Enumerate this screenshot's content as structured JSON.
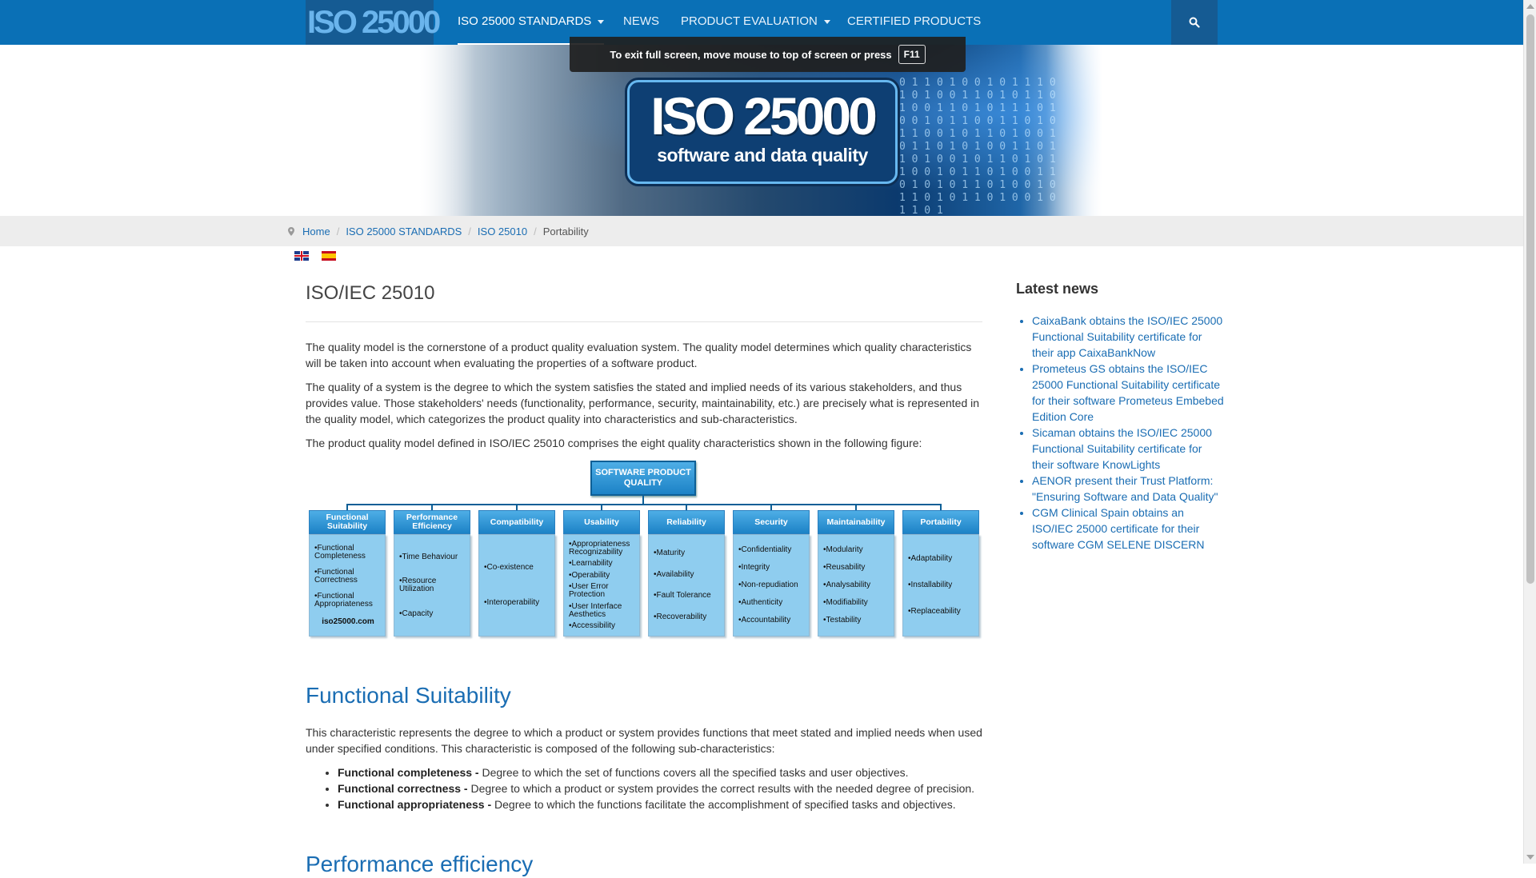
{
  "header": {
    "logo_text": "ISO 25000",
    "nav": [
      {
        "label": "ISO 25000 STANDARDS"
      },
      {
        "label": "NEWS"
      },
      {
        "label": "PRODUCT EVALUATION"
      },
      {
        "label": "CERTIFIED PRODUCTS"
      }
    ],
    "search_icon": "search-icon"
  },
  "fullscreen_notice": {
    "text": "To exit full screen, move mouse to top of screen or press",
    "key": "F11"
  },
  "banner": {
    "title": "ISO 25000",
    "subtitle": "software and data quality"
  },
  "breadcrumb": {
    "items": [
      "Home",
      "ISO 25000 STANDARDS",
      "ISO 25010"
    ],
    "current": "Portability"
  },
  "languages": [
    "en-flag-icon",
    "es-flag-icon"
  ],
  "main": {
    "title": "ISO/IEC 25010",
    "paragraphs": [
      "The quality model is the cornerstone of a product quality evaluation system. The quality model determines which quality characteristics will be taken into account when evaluating the properties of a software product.",
      "The quality of a system is the degree to which the system satisfies the stated and implied needs of its various stakeholders, and thus provides value. Those stakeholders' needs (functionality, performance, security, maintainability, etc.) are precisely what is represented in the quality model, which categorizes the product quality into characteristics and sub-characteristics.",
      "The product quality model defined in ISO/IEC 25010 comprises the eight quality characteristics shown in the following figure:"
    ],
    "figure": {
      "root": "SOFTWARE PRODUCT QUALITY",
      "watermark": "iso25000.com",
      "columns": [
        {
          "title": "Functional Suitability",
          "items": [
            "Functional Completeness",
            "Functional Correctness",
            "Functional Appropriateness"
          ]
        },
        {
          "title": "Performance Efficiency",
          "items": [
            "Time Behaviour",
            "Resource Utilization",
            "Capacity"
          ]
        },
        {
          "title": "Compatibility",
          "items": [
            "Co-existence",
            "Interoperability"
          ]
        },
        {
          "title": "Usability",
          "items": [
            "Appropriateness Recognizability",
            "Learnability",
            "Operability",
            "User Error Protection",
            "User Interface Aesthetics",
            "Accessibility"
          ]
        },
        {
          "title": "Reliability",
          "items": [
            "Maturity",
            "Availability",
            "Fault Tolerance",
            "Recoverability"
          ]
        },
        {
          "title": "Security",
          "items": [
            "Confidentiality",
            "Integrity",
            "Non-repudiation",
            "Authenticity",
            "Accountability"
          ]
        },
        {
          "title": "Maintainability",
          "items": [
            "Modularity",
            "Reusability",
            "Analysability",
            "Modifiability",
            "Testability"
          ]
        },
        {
          "title": "Portability",
          "items": [
            "Adaptability",
            "Installability",
            "Replaceability"
          ]
        }
      ]
    },
    "section1": {
      "title": "Functional Suitability",
      "intro": "This characteristic represents the degree to which a product or system provides functions that meet stated and implied needs when used under specified conditions. This characteristic is composed of the following sub-characteristics:",
      "bullets": [
        {
          "term": "Functional completeness -",
          "text": " Degree to which the set of functions covers all the specified tasks and user objectives."
        },
        {
          "term": "Functional correctness -",
          "text": " Degree to which a product or system provides the correct results with the needed degree of precision."
        },
        {
          "term": "Functional appropriateness -",
          "text": " Degree to which the functions facilitate the accomplishment of specified tasks and objectives."
        }
      ]
    },
    "section2": {
      "title": "Performance efficiency"
    }
  },
  "sidebar": {
    "title": "Latest news",
    "news": [
      "CaixaBank obtains the ISO/IEC 25000 Functional Suitability certificate for their app CaixaBankNow",
      "Prometeus GS obtains the ISO/IEC 25000 Functional Suitability certificate for their software Prometeus Embebed Edition Core",
      "Sicaman obtains the ISO/IEC 25000 Functional Suitability certificate for their software KnowLights",
      "AENOR present their Trust Platform: \"Ensuring Software and Data Quality\"",
      "CGM Clinical Spain obtains an ISO/IEC 25000 certificate for their software CGM SELENE DISCERN"
    ]
  }
}
